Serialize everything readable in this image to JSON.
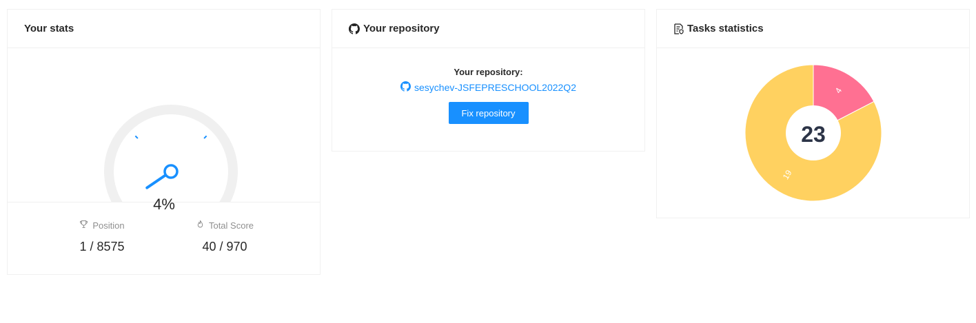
{
  "stats_card": {
    "title": "Your stats",
    "gauge_percent": 4,
    "gauge_label": "4%",
    "position_label": "Position",
    "position_value": "1 / 8575",
    "score_label": "Total Score",
    "score_value": "40 / 970"
  },
  "repo_card": {
    "title": "Your repository",
    "caption": "Your repository:",
    "repo_name": "sesychev-JSFEPRESCHOOL2022Q2",
    "fix_button": "Fix repository"
  },
  "tasks_card": {
    "title": "Tasks statistics",
    "total": "23"
  },
  "chart_data": {
    "type": "pie",
    "series": [
      {
        "value": 4,
        "color": "#ff7092"
      },
      {
        "value": 19,
        "color": "#ffd160"
      }
    ],
    "center_label": "23"
  },
  "colors": {
    "accent": "#1890ff",
    "gauge_track": "#f0f0f0"
  }
}
